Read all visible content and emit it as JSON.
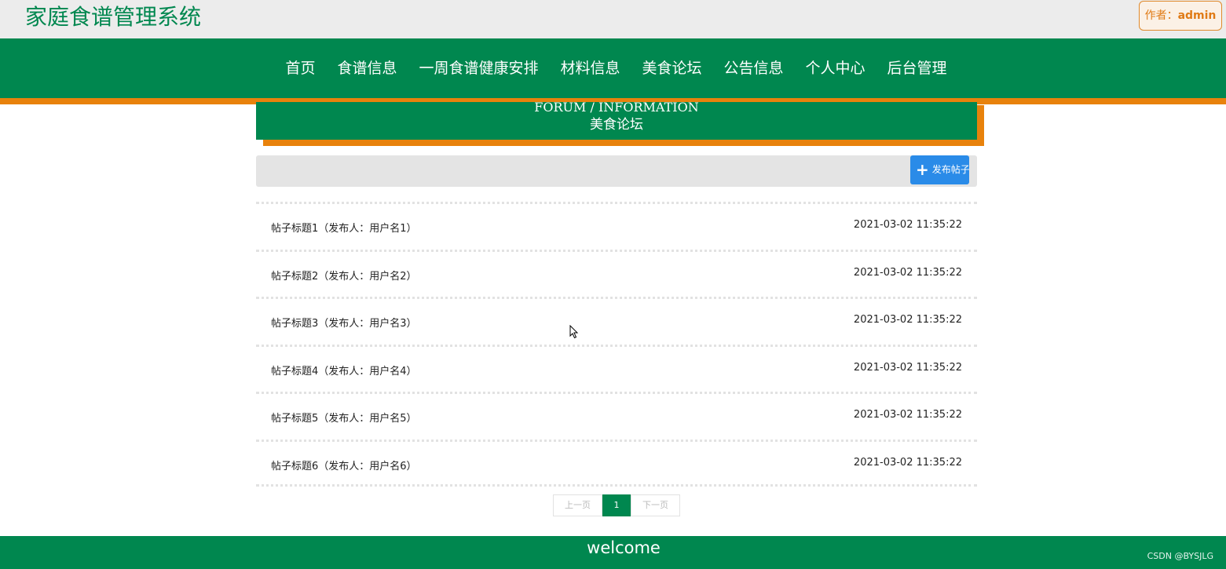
{
  "header": {
    "site_title": "家庭食谱管理系统",
    "author_label": "作者：",
    "author_name": "admin"
  },
  "nav": {
    "items": [
      {
        "label": "首页"
      },
      {
        "label": "食谱信息"
      },
      {
        "label": "一周食谱健康安排"
      },
      {
        "label": "材料信息"
      },
      {
        "label": "美食论坛"
      },
      {
        "label": "公告信息"
      },
      {
        "label": "个人中心"
      },
      {
        "label": "后台管理"
      }
    ]
  },
  "section": {
    "title_en": "FORUM / INFORMATION",
    "title_cn": "美食论坛"
  },
  "toolbar": {
    "publish_label": "发布帖子"
  },
  "posts": [
    {
      "title": "帖子标题1（发布人：用户名1）",
      "time": "2021-03-02 11:35:22"
    },
    {
      "title": "帖子标题2（发布人：用户名2）",
      "time": "2021-03-02 11:35:22"
    },
    {
      "title": "帖子标题3（发布人：用户名3）",
      "time": "2021-03-02 11:35:22"
    },
    {
      "title": "帖子标题4（发布人：用户名4）",
      "time": "2021-03-02 11:35:22"
    },
    {
      "title": "帖子标题5（发布人：用户名5）",
      "time": "2021-03-02 11:35:22"
    },
    {
      "title": "帖子标题6（发布人：用户名6）",
      "time": "2021-03-02 11:35:22"
    }
  ],
  "pagination": {
    "prev_label": "上一页",
    "current_page": "1",
    "next_label": "下一页"
  },
  "footer": {
    "welcome": "welcome",
    "watermark": "CSDN @BYSJLG"
  },
  "colors": {
    "primary_green": "#00874f",
    "accent_orange": "#e8820c",
    "button_blue": "#2a8be8"
  }
}
